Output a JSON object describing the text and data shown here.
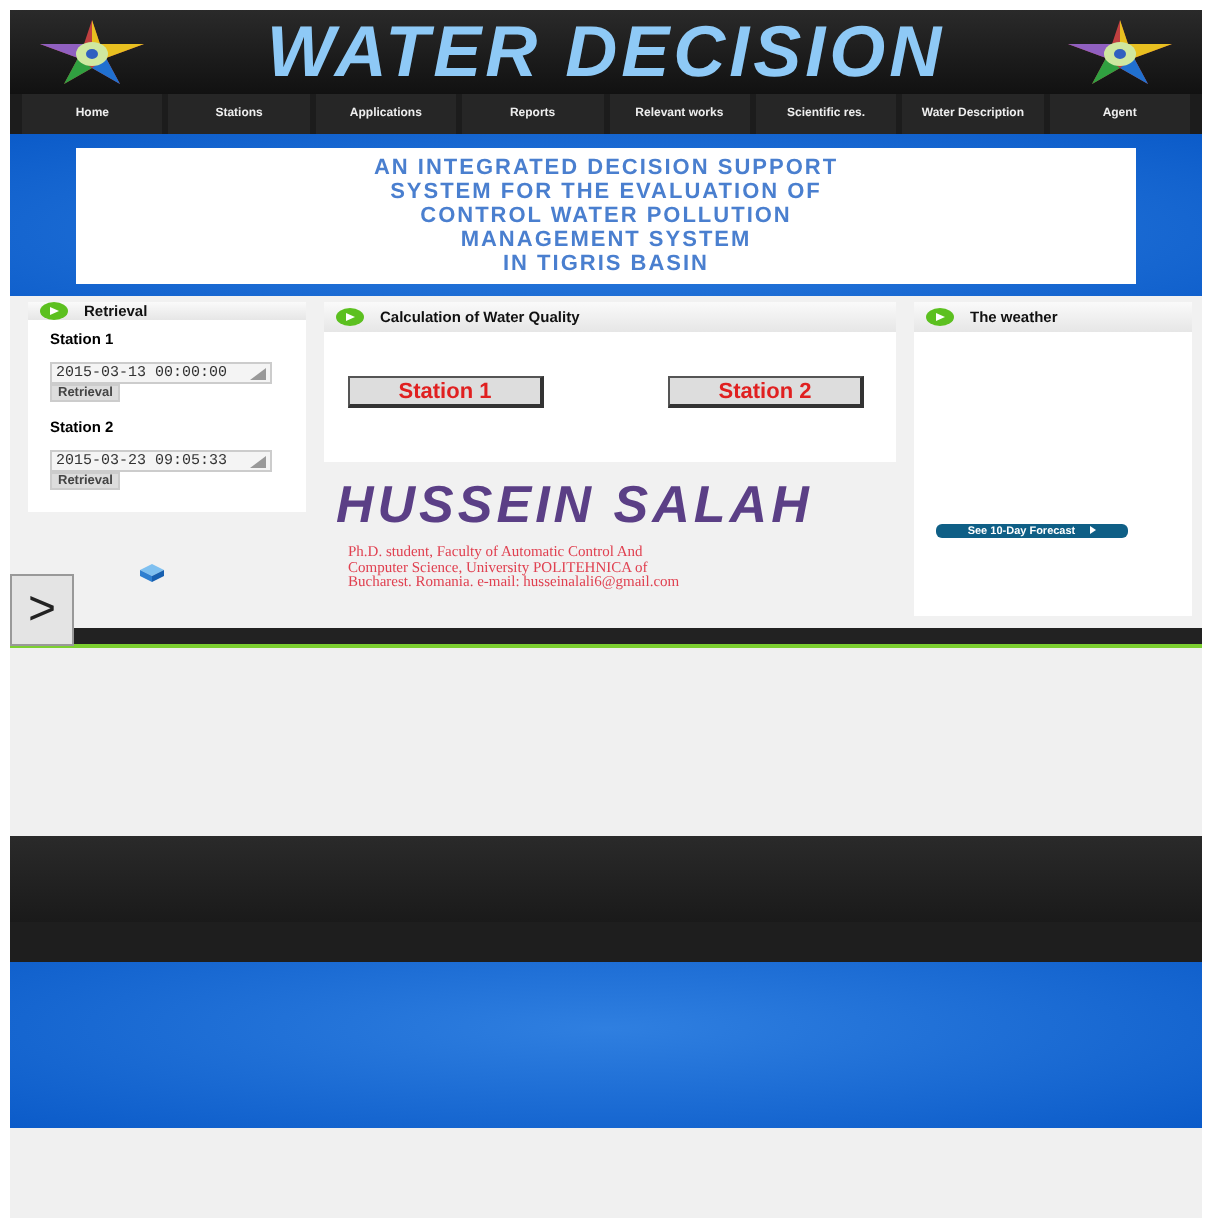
{
  "header": {
    "title": "WATER DECISION"
  },
  "nav": [
    {
      "label": "Home"
    },
    {
      "label": "Stations"
    },
    {
      "label": "Applications"
    },
    {
      "label": "Reports"
    },
    {
      "label": "Relevant works"
    },
    {
      "label": "Scientific res."
    },
    {
      "label": "Water Description"
    },
    {
      "label": "Agent"
    }
  ],
  "banner": {
    "lines": [
      "AN INTEGRATED DECISION SUPPORT",
      "SYSTEM FOR THE EVALUATION OF",
      "CONTROL WATER POLLUTION",
      "MANAGEMENT SYSTEM",
      "IN TIGRIS BASIN"
    ]
  },
  "retrieval": {
    "title": "Retrieval",
    "stations": [
      {
        "label": "Station 1",
        "value": "2015-03-13 00:00:00",
        "button": "Retrieval"
      },
      {
        "label": "Station 2",
        "value": "2015-03-23 09:05:33",
        "button": "Retrieval"
      }
    ]
  },
  "quality": {
    "title": "Calculation of Water Quality",
    "buttons": [
      "Station 1",
      "Station 2"
    ]
  },
  "author": {
    "name": "HUSSEIN SALAH",
    "lines": [
      "Ph.D. student, Faculty of Automatic Control And",
      "Computer Science, University POLITEHNICA of",
      "Bucharest. Romania. e-mail: husseinalali6@gmail.com"
    ]
  },
  "weather": {
    "title": "The weather",
    "forecast_button": "See 10-Day Forecast"
  },
  "side_tab": {
    "label": ">"
  }
}
